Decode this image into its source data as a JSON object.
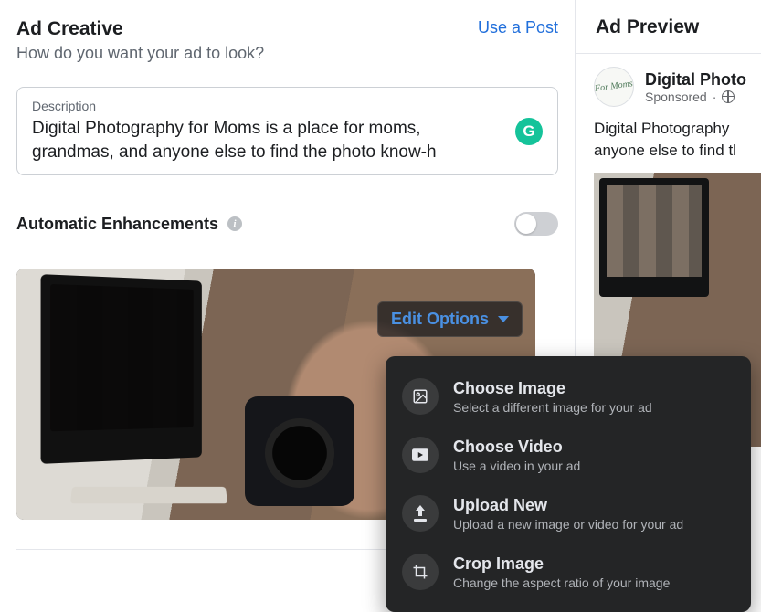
{
  "left": {
    "title": "Ad Creative",
    "subtitle": "How do you want your ad to look?",
    "use_post": "Use a Post",
    "description": {
      "label": "Description",
      "value": "Digital Photography for Moms is a place for moms,\ngrandmas, and anyone else to find the photo know-h"
    },
    "auto_enhancements": {
      "label": "Automatic Enhancements",
      "enabled": false
    },
    "edit_options": {
      "button_label": "Edit Options",
      "items": [
        {
          "title": "Choose Image",
          "sub": "Select a different image for your ad",
          "icon": "image-icon"
        },
        {
          "title": "Choose Video",
          "sub": "Use a video in your ad",
          "icon": "video-icon"
        },
        {
          "title": "Upload New",
          "sub": "Upload a new image or video for your ad",
          "icon": "upload-icon"
        },
        {
          "title": "Crop Image",
          "sub": "Change the aspect ratio of your image",
          "icon": "crop-icon"
        }
      ]
    }
  },
  "preview": {
    "header": "Ad Preview",
    "page_name": "Digital Photo",
    "sponsored": "Sponsored",
    "avatar_text": "For Moms",
    "body": "Digital Photography \nanyone else to find tl"
  }
}
